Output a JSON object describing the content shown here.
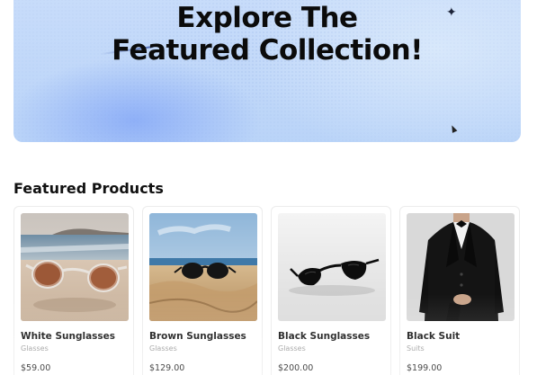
{
  "hero": {
    "title_line1": "Explore The",
    "title_line2": "Featured Collection!"
  },
  "featured": {
    "heading": "Featured Products",
    "products": [
      {
        "name": "White Sunglasses",
        "category": "Glasses",
        "price": "$59.00",
        "image": "white-sunglasses-on-beach-photo"
      },
      {
        "name": "Brown Sunglasses",
        "category": "Glasses",
        "price": "$129.00",
        "image": "brown-sunglasses-on-sand-photo"
      },
      {
        "name": "Black Sunglasses",
        "category": "Glasses",
        "price": "$200.00",
        "image": "black-sunglasses-studio-photo"
      },
      {
        "name": "Black Suit",
        "category": "Suits",
        "price": "$199.00",
        "image": "black-suit-model-photo"
      }
    ]
  },
  "colors": {
    "hero_bg": "#c8dcfa",
    "hero_blob": "#8fb0f7",
    "text": "#111111",
    "muted": "#9a9a9a"
  }
}
